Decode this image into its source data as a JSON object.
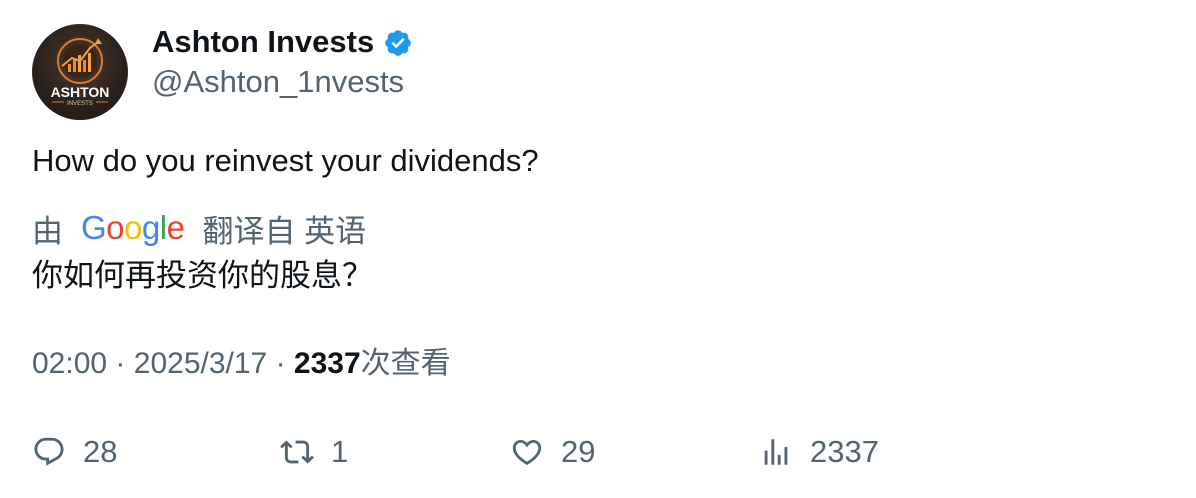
{
  "author": {
    "display_name": "Ashton Invests",
    "handle": "@Ashton_1nvests",
    "avatar_text": "ASHTON",
    "avatar_subtext": "INVESTS",
    "verified": true
  },
  "tweet": {
    "text": "How do you reinvest your dividends?"
  },
  "translation": {
    "prefix": "由",
    "provider": "Google",
    "suffix": "翻译自 英语",
    "text": "你如何再投资你的股息？"
  },
  "meta": {
    "time": "02:00",
    "separator": "·",
    "date": "2025/3/17",
    "views_count": "2337",
    "views_label": "次查看"
  },
  "actions": {
    "reply_count": "28",
    "retweet_count": "1",
    "like_count": "29",
    "views_count": "2337"
  },
  "colors": {
    "text_primary": "#0f1419",
    "text_secondary": "#536471",
    "verified_blue": "#1d9bf0"
  }
}
